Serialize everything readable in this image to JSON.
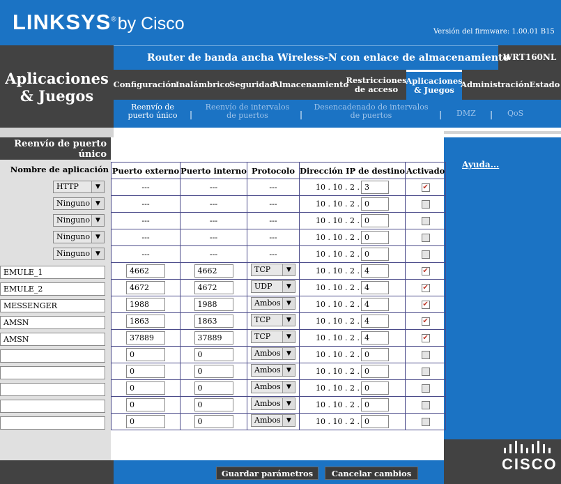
{
  "header": {
    "brand": "LINKSYS",
    "brand_suffix": "by Cisco",
    "firmware": "Versión del firmware: 1.00.01 B15",
    "product_title": "Router de banda ancha Wireless-N con enlace de almacenamiento",
    "model": "WRT160NL",
    "section_title_line1": "Aplicaciones",
    "section_title_line2": "& Juegos"
  },
  "main_tabs": [
    {
      "label": "Configuración"
    },
    {
      "label": "Inalámbrico"
    },
    {
      "label": "Seguridad"
    },
    {
      "label": "Almacenamiento"
    },
    {
      "label": "Restricciones de acceso"
    },
    {
      "label": "Aplicaciones & Juegos",
      "active": true
    },
    {
      "label": "Administración"
    },
    {
      "label": "Estado"
    }
  ],
  "sub_tabs": [
    {
      "label": "Reenvío de puerto único",
      "active": true
    },
    {
      "label": "Reenvío de intervalos de puertos"
    },
    {
      "label": "Desencadenado de intervalos de puertos"
    },
    {
      "label": "DMZ"
    },
    {
      "label": "QoS"
    }
  ],
  "left": {
    "section_header": "Reenvío de puerto único",
    "app_name_label": "Nombre de aplicación"
  },
  "table": {
    "headers": [
      "Puerto externo",
      "Puerto interno",
      "Protocolo",
      "Dirección IP de destino",
      "Activado"
    ],
    "ip_prefix": "10 . 10 . 2 .",
    "preset_rows": [
      {
        "app": "HTTP",
        "ext": "---",
        "int": "---",
        "proto": "---",
        "ip": "3",
        "enabled": true
      },
      {
        "app": "Ninguno",
        "ext": "---",
        "int": "---",
        "proto": "---",
        "ip": "0",
        "enabled": false
      },
      {
        "app": "Ninguno",
        "ext": "---",
        "int": "---",
        "proto": "---",
        "ip": "0",
        "enabled": false
      },
      {
        "app": "Ninguno",
        "ext": "---",
        "int": "---",
        "proto": "---",
        "ip": "0",
        "enabled": false
      },
      {
        "app": "Ninguno",
        "ext": "---",
        "int": "---",
        "proto": "---",
        "ip": "0",
        "enabled": false
      }
    ],
    "custom_rows": [
      {
        "app": "EMULE_1",
        "ext": "4662",
        "int": "4662",
        "proto": "TCP",
        "ip": "4",
        "enabled": true
      },
      {
        "app": "EMULE_2",
        "ext": "4672",
        "int": "4672",
        "proto": "UDP",
        "ip": "4",
        "enabled": true
      },
      {
        "app": "MESSENGER",
        "ext": "1988",
        "int": "1988",
        "proto": "Ambos",
        "ip": "4",
        "enabled": true
      },
      {
        "app": "AMSN",
        "ext": "1863",
        "int": "1863",
        "proto": "TCP",
        "ip": "4",
        "enabled": true
      },
      {
        "app": "AMSN",
        "ext": "37889",
        "int": "37889",
        "proto": "TCP",
        "ip": "4",
        "enabled": true
      },
      {
        "app": "",
        "ext": "0",
        "int": "0",
        "proto": "Ambos",
        "ip": "0",
        "enabled": false
      },
      {
        "app": "",
        "ext": "0",
        "int": "0",
        "proto": "Ambos",
        "ip": "0",
        "enabled": false
      },
      {
        "app": "",
        "ext": "0",
        "int": "0",
        "proto": "Ambos",
        "ip": "0",
        "enabled": false
      },
      {
        "app": "",
        "ext": "0",
        "int": "0",
        "proto": "Ambos",
        "ip": "0",
        "enabled": false
      },
      {
        "app": "",
        "ext": "0",
        "int": "0",
        "proto": "Ambos",
        "ip": "0",
        "enabled": false
      }
    ]
  },
  "help": {
    "link": "Ayuda..."
  },
  "buttons": {
    "save": "Guardar parámetros",
    "cancel": "Cancelar cambios"
  },
  "footer": {
    "cisco_logo_text": "cisco"
  },
  "colors": {
    "brand_blue": "#1b73c4",
    "dark_gray": "#424242",
    "check_red": "#c0392b"
  }
}
